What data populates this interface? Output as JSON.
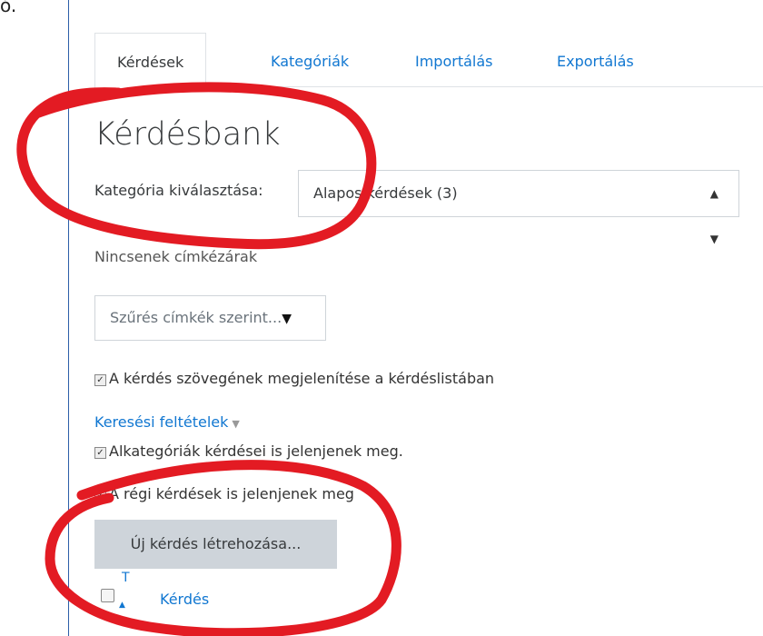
{
  "stray_text": "ó.",
  "tabs": [
    "Kérdések",
    "Kategóriák",
    "Importálás",
    "Exportálás"
  ],
  "title": "Kérdésbank",
  "category": {
    "label": "Kategória kiválasztása:",
    "selected": "Alapos kérdések (3)"
  },
  "obscured_text": "Nincsenek címkézárak",
  "tag_filter": {
    "placeholder": "Szűrés címkék szerint...",
    "arrow": "▼"
  },
  "options": {
    "show_text": "A kérdés szövegének megjelenítése a kérdéslistában",
    "search_link": "Keresési feltételek",
    "subcategories": "Alkategóriák kérdései is jelenjenek meg.",
    "old_questions": "A régi kérdések is jelenjenek meg"
  },
  "create_button": "Új kérdés létrehozása...",
  "table": {
    "sort_label": "T",
    "column_question": "Kérdés"
  },
  "colors": {
    "annotation": "#e31b23",
    "link": "#1177d1"
  }
}
